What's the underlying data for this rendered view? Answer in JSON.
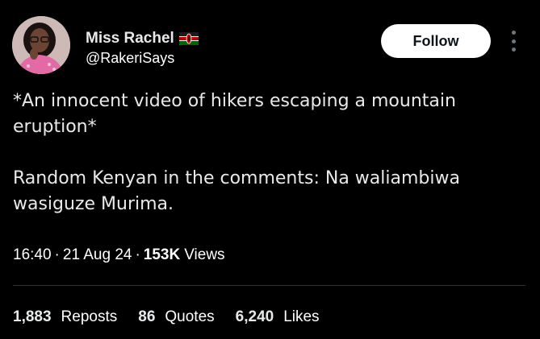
{
  "author": {
    "display_name": "Miss Rachel",
    "flag_icon": "kenya-flag-icon",
    "handle": "@RakeriSays"
  },
  "actions": {
    "follow_label": "Follow",
    "more_icon": "more-options-icon"
  },
  "tweet": {
    "paragraph_1": "*An innocent video of hikers escaping a mountain eruption*",
    "paragraph_2": "Random Kenyan in the comments: Na waliambiwa wasiguze Murima."
  },
  "meta": {
    "time": "16:40",
    "date": "21 Aug 24",
    "views_count": "153K",
    "views_label": "Views"
  },
  "stats": {
    "reposts_count": "1,883",
    "reposts_label": "Reposts",
    "quotes_count": "86",
    "quotes_label": "Quotes",
    "likes_count": "6,240",
    "likes_label": "Likes"
  },
  "colors": {
    "background": "#000000",
    "text_primary": "#e7e9ea",
    "divider": "#2f3336",
    "follow_bg": "#ffffff"
  }
}
